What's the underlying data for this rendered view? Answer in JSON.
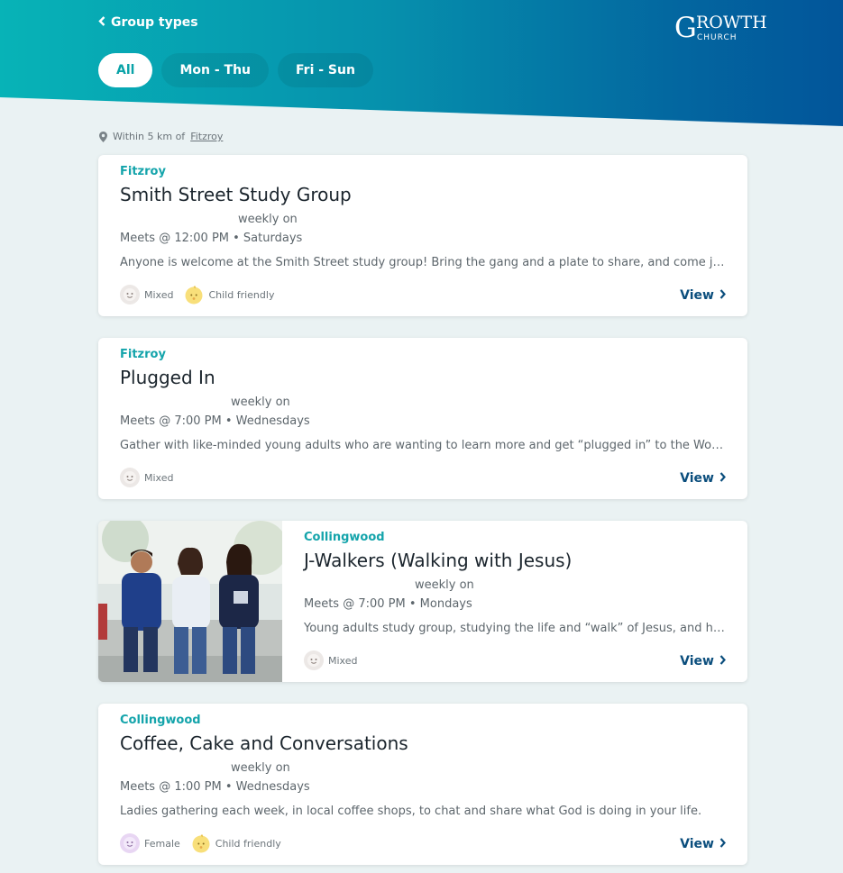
{
  "header": {
    "back_label": "Group types",
    "logo_g": "G",
    "logo_rest": "ROWTH",
    "logo_sub": "CHURCH",
    "filters": [
      {
        "label": "All",
        "active": true
      },
      {
        "label": "Mon - Thu",
        "active": false
      },
      {
        "label": "Fri - Sun",
        "active": false
      }
    ]
  },
  "location": {
    "prefix": "Within 5 km of",
    "place": "Fitzroy"
  },
  "view_label": "View",
  "groups": [
    {
      "suburb": "Fitzroy",
      "title": "Smith Street Study Group",
      "frequency": "weekly on",
      "meets": "Meets @ 12:00 PM • Saturdays",
      "description": "Anyone is welcome at the Smith Street study group! Bring the gang and a plate to share, and come join in.",
      "tags": [
        {
          "label": "Mixed",
          "icon": "mixed-face-icon"
        },
        {
          "label": "Child friendly",
          "icon": "baby-face-icon"
        }
      ]
    },
    {
      "suburb": "Fitzroy",
      "title": "Plugged In",
      "frequency": "weekly on",
      "meets": "Meets @ 7:00 PM • Wednesdays",
      "description": "Gather with like-minded young adults who are wanting to learn more and get “plugged in” to the Word.",
      "tags": [
        {
          "label": "Mixed",
          "icon": "mixed-face-icon"
        }
      ]
    },
    {
      "suburb": "Collingwood",
      "title": "J-Walkers (Walking with Jesus)",
      "frequency": "weekly on",
      "meets": "Meets @ 7:00 PM • Mondays",
      "description": "Young adults study group, studying the life and “walk” of Jesus, and how we can walk with Him today.",
      "tags": [
        {
          "label": "Mixed",
          "icon": "mixed-face-icon"
        }
      ]
    },
    {
      "suburb": "Collingwood",
      "title": "Coffee, Cake and Conversations",
      "frequency": "weekly on",
      "meets": "Meets @ 1:00 PM • Wednesdays",
      "description": "Ladies gathering each week, in local coffee shops, to chat and share what God is doing in your life.",
      "tags": [
        {
          "label": "Female",
          "icon": "female-face-icon"
        },
        {
          "label": "Child friendly",
          "icon": "baby-face-icon"
        }
      ]
    }
  ]
}
